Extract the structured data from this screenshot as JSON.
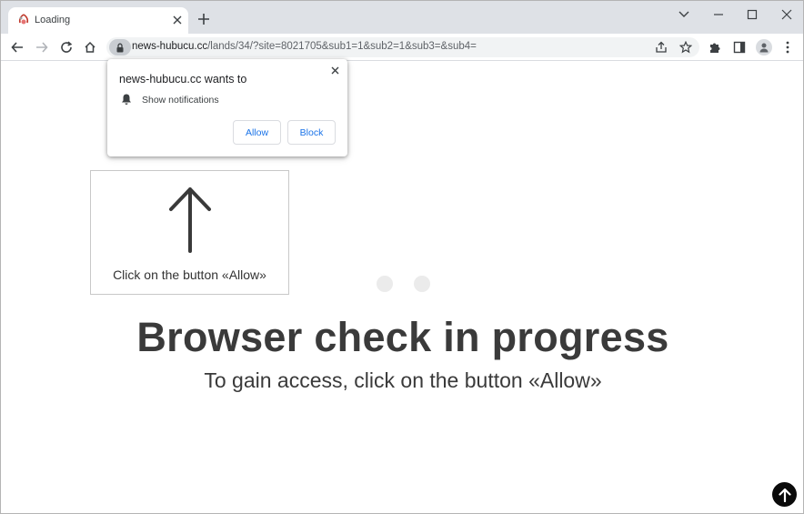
{
  "tab": {
    "title": "Loading",
    "favicon": "loading-favicon-icon"
  },
  "address": {
    "host": "news-hubucu.cc",
    "path": "/lands/34/?site=8021705&sub1=1&sub2=1&sub3=&sub4="
  },
  "permission_prompt": {
    "title": "news-hubucu.cc wants to",
    "item": "Show notifications",
    "allow_label": "Allow",
    "block_label": "Block"
  },
  "page": {
    "hint": "Click on the button «Allow»",
    "headline": "Browser check in progress",
    "subline": "To gain access, click on the button «Allow»"
  },
  "colors": {
    "accent": "#1a73e8",
    "headline": "#3a3a3a",
    "tabstrip": "#dee1e6"
  }
}
